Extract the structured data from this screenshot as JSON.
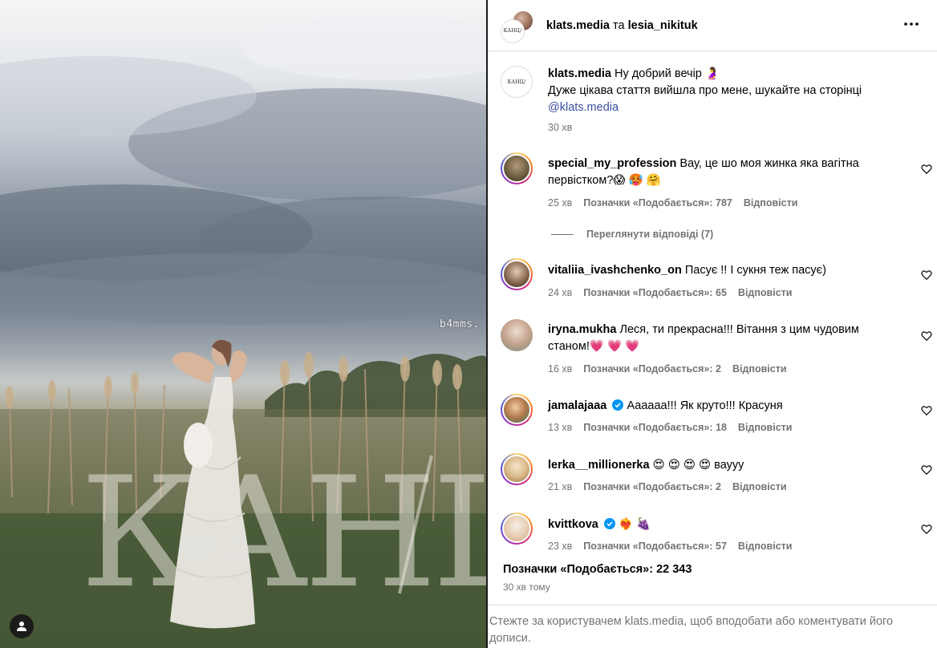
{
  "watermark": "b4mms.",
  "photo_brand": "КАНЦ/",
  "header": {
    "user1": "klats.media",
    "conjunction": "та",
    "user2": "lesia_nikituk",
    "logo_text": "КАНЦ/"
  },
  "caption": {
    "username": "klats.media",
    "text_line1": "Ну добрий вечір 🤰",
    "text_line2": "Дуже цікава стаття вийшла про мене, шукайте на сторінці",
    "mention": "@klats.media",
    "time": "30 хв"
  },
  "comments": [
    {
      "username": "special_my_profession",
      "verified": false,
      "text": "Вау, це шо моя жинка яка вагітна первістком?😱 🥵 🤗",
      "time": "25 хв",
      "likes": "Позначки «Подобається»: 787",
      "reply": "Відповісти"
    },
    {
      "username": "vitaliia_ivashchenko_on",
      "verified": false,
      "text": "Пасує !! І сукня теж пасує)",
      "time": "24 хв",
      "likes": "Позначки «Подобається»: 65",
      "reply": "Відповісти"
    },
    {
      "username": "iryna.mukha",
      "verified": false,
      "text": "Леся, ти прекрасна!!! Вітання з цим чудовим станом!💗 💗 💗",
      "time": "16 хв",
      "likes": "Позначки «Подобається»: 2",
      "reply": "Відповісти"
    },
    {
      "username": "jamalajaaa",
      "verified": true,
      "text": "Аааааа!!! Як круто!!! Красуня",
      "time": "13 хв",
      "likes": "Позначки «Подобається»: 18",
      "reply": "Відповісти"
    },
    {
      "username": "lerka__millionerka",
      "verified": false,
      "text": "😍 😍 😍 😍 вауyy",
      "time": "21 хв",
      "likes": "Позначки «Подобається»: 2",
      "reply": "Відповісти"
    },
    {
      "username": "kvittkova",
      "verified": true,
      "text": "❤️‍🔥 🍇",
      "time": "23 хв",
      "likes": "Позначки «Подобається»: 57",
      "reply": "Відповісти"
    }
  ],
  "view_replies": "Переглянути відповіді (7)",
  "likes_total": "Позначки «Подобається»: 22 343",
  "time_ago": "30 хв тому",
  "footer_text": "Стежте за користувачем klats.media, щоб вподобати або коментувати його дописи.",
  "icons": {
    "more": "more-horizontal-icon",
    "heart": "heart-outline-icon",
    "verified": "verified-badge-icon",
    "user_tag": "user-tag-icon"
  },
  "colors": {
    "verified": "#0095f6",
    "meta_text": "#737373",
    "mention": "#3a4ea3",
    "divider": "#dbdbdb"
  }
}
